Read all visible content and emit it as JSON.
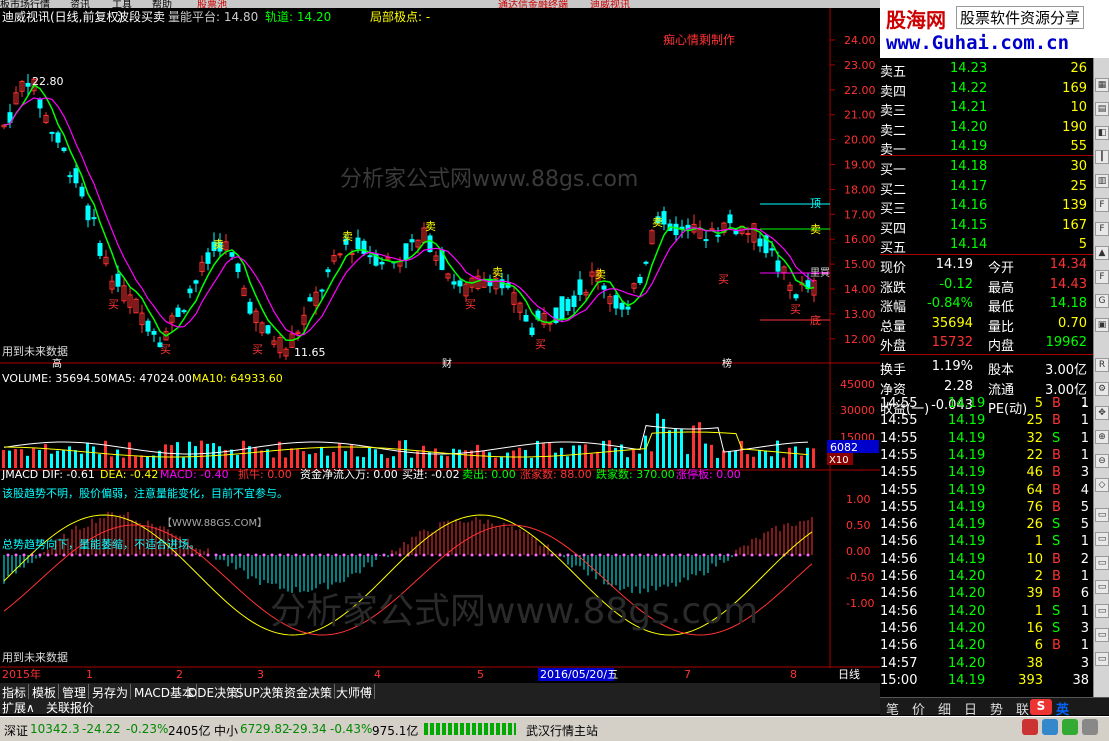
{
  "top_menu": {
    "items": [
      "板市场行情",
      "资讯",
      "工具",
      "帮助"
    ],
    "tab": "股票池",
    "ticker": [
      "通达信金融终端",
      "迪威视讯"
    ]
  },
  "chart": {
    "header": {
      "title": "迪威视讯(日线,前复权)",
      "indicator": "波段买卖",
      "vol_platform": "量能平台: 14.80",
      "track": "轨道: 14.20",
      "extreme": "局部极点: -"
    },
    "watermark": "分析家公式网www.88gs.com",
    "watermark2": "分析家公式网www.88gs.com",
    "author": "痴心情剩制作",
    "future_note": "用到未来数据",
    "future_note2": "用到未来数据",
    "high_label": "22.80",
    "low_label": "11.65",
    "price_axis": [
      "24.00",
      "23.00",
      "22.00",
      "21.00",
      "20.00",
      "19.00",
      "18.00",
      "17.00",
      "16.00",
      "15.00",
      "14.00",
      "13.00",
      "12.00"
    ],
    "right_marks": [
      "顶",
      "卖",
      "里買",
      "底"
    ],
    "event_marks": [
      "高",
      "财",
      "榜"
    ],
    "signals": {
      "sell": "卖",
      "buy": "买"
    },
    "volume": {
      "header": "VOLUME: 35694.50",
      "ma5": "MA5: 47024.00",
      "ma10": "MA10: 64933.60",
      "axis": [
        "45000",
        "30000",
        "15000"
      ],
      "box1": "6082",
      "box2": "X10"
    },
    "macd": {
      "name": "JMACD",
      "dif": "DIF: -0.61",
      "dea": "DEA: -0.42",
      "macd": "MACD: -0.40",
      "grab": "抓牛: 0.00",
      "fund": "资金净流入万: 0.00",
      "buy_in": "买进: -0.02",
      "sell_out": "卖出: 0.00",
      "up_count": "涨家数: 88.00",
      "down_count": "跌家数: 370.00",
      "limit": "涨停板: 0.00",
      "msg1": "该股趋势不明，股价偏弱，注意量能变化，目前不宜参与。",
      "msg2": "【WWW.88GS.COM】",
      "msg3": "总势趋势向下，量能萎缩，不适合进场。",
      "axis": [
        "1.00",
        "0.50",
        "0.00",
        "-0.50",
        "-1.00"
      ]
    },
    "date_axis": {
      "start": "2015年",
      "labels": [
        "1",
        "2",
        "3",
        "4",
        "5",
        "6",
        "7",
        "8"
      ],
      "cursor": "2016/05/20/五",
      "period": "日线"
    }
  },
  "logo": {
    "title": "股海网",
    "slogan": "股票软件资源分享",
    "url": "www.Guhai.com.cn"
  },
  "orderbook": [
    {
      "label": "卖五",
      "price": "14.23",
      "vol": "26"
    },
    {
      "label": "卖四",
      "price": "14.22",
      "vol": "169"
    },
    {
      "label": "卖三",
      "price": "14.21",
      "vol": "10"
    },
    {
      "label": "卖二",
      "price": "14.20",
      "vol": "190"
    },
    {
      "label": "卖一",
      "price": "14.19",
      "vol": "55"
    },
    {
      "label": "买一",
      "price": "14.18",
      "vol": "30"
    },
    {
      "label": "买二",
      "price": "14.17",
      "vol": "25"
    },
    {
      "label": "买三",
      "price": "14.16",
      "vol": "139"
    },
    {
      "label": "买四",
      "price": "14.15",
      "vol": "167"
    },
    {
      "label": "买五",
      "price": "14.14",
      "vol": "5"
    }
  ],
  "stats": [
    {
      "l1": "现价",
      "v1": "14.19",
      "l2": "今开",
      "v2": "14.34",
      "c1": "#fff",
      "c2": "#f33"
    },
    {
      "l1": "涨跌",
      "v1": "-0.12",
      "l2": "最高",
      "v2": "14.43",
      "c1": "#0f0",
      "c2": "#f33"
    },
    {
      "l1": "涨幅",
      "v1": "-0.84%",
      "l2": "最低",
      "v2": "14.18",
      "c1": "#0f0",
      "c2": "#0f0"
    },
    {
      "l1": "总量",
      "v1": "35694",
      "l2": "量比",
      "v2": "0.70",
      "c1": "#ff0",
      "c2": "#ff0"
    },
    {
      "l1": "外盘",
      "v1": "15732",
      "l2": "内盘",
      "v2": "19962",
      "c1": "#f33",
      "c2": "#0f0"
    },
    {
      "l1": "换手",
      "v1": "1.19%",
      "l2": "股本",
      "v2": "3.00亿",
      "c1": "#fff",
      "c2": "#fff"
    },
    {
      "l1": "净资",
      "v1": "2.28",
      "l2": "流通",
      "v2": "3.00亿",
      "c1": "#fff",
      "c2": "#fff"
    },
    {
      "l1": "收益(一)",
      "v1": "-0.043",
      "l2": "PE(动)",
      "v2": "-",
      "c1": "#fff",
      "c2": "#fff"
    }
  ],
  "ticks": [
    {
      "t": "14:55",
      "p": "14.19",
      "v": "5",
      "d": "B",
      "n": "1"
    },
    {
      "t": "14:55",
      "p": "14.19",
      "v": "25",
      "d": "B",
      "n": "1"
    },
    {
      "t": "14:55",
      "p": "14.19",
      "v": "32",
      "d": "S",
      "n": "1"
    },
    {
      "t": "14:55",
      "p": "14.19",
      "v": "22",
      "d": "B",
      "n": "1"
    },
    {
      "t": "14:55",
      "p": "14.19",
      "v": "46",
      "d": "B",
      "n": "3"
    },
    {
      "t": "14:55",
      "p": "14.19",
      "v": "64",
      "d": "B",
      "n": "4"
    },
    {
      "t": "14:55",
      "p": "14.19",
      "v": "76",
      "d": "B",
      "n": "5"
    },
    {
      "t": "14:56",
      "p": "14.19",
      "v": "26",
      "d": "S",
      "n": "5"
    },
    {
      "t": "14:56",
      "p": "14.19",
      "v": "1",
      "d": "S",
      "n": "1"
    },
    {
      "t": "14:56",
      "p": "14.19",
      "v": "10",
      "d": "B",
      "n": "2"
    },
    {
      "t": "14:56",
      "p": "14.20",
      "v": "2",
      "d": "B",
      "n": "1"
    },
    {
      "t": "14:56",
      "p": "14.20",
      "v": "39",
      "d": "B",
      "n": "6"
    },
    {
      "t": "14:56",
      "p": "14.20",
      "v": "1",
      "d": "S",
      "n": "1"
    },
    {
      "t": "14:56",
      "p": "14.20",
      "v": "16",
      "d": "S",
      "n": "3"
    },
    {
      "t": "14:56",
      "p": "14.20",
      "v": "6",
      "d": "B",
      "n": "1"
    },
    {
      "t": "14:57",
      "p": "14.20",
      "v": "38",
      "d": "",
      "n": "3"
    },
    {
      "t": "15:00",
      "p": "14.19",
      "v": "393",
      "d": "",
      "n": "38"
    }
  ],
  "left_tabs": [
    "指标",
    "模板",
    "管理",
    "另存为",
    "MACD基本",
    "DDE决策",
    "SUP决策",
    "资金决策",
    "大师傅"
  ],
  "left_tabs2": [
    "扩展∧",
    "关联报价"
  ],
  "right_tabs": [
    "笔",
    "价",
    "细",
    "日",
    "势",
    "联"
  ],
  "status": {
    "sz": "深证",
    "sz_val": "10342.3",
    "sz_chg": "-24.22",
    "sz_pct": "-0.23%",
    "sz_amt": "2405亿",
    "zx": "中小",
    "zx_val": "6729.82",
    "zx_chg": "-29.34",
    "zx_pct": "-0.43%",
    "zx_amt": "975.1亿",
    "station": "武汉行情主站",
    "ime": "英"
  },
  "colors": {
    "up": "#ff3232",
    "down": "#00ffff",
    "vol": "#ffff00"
  }
}
